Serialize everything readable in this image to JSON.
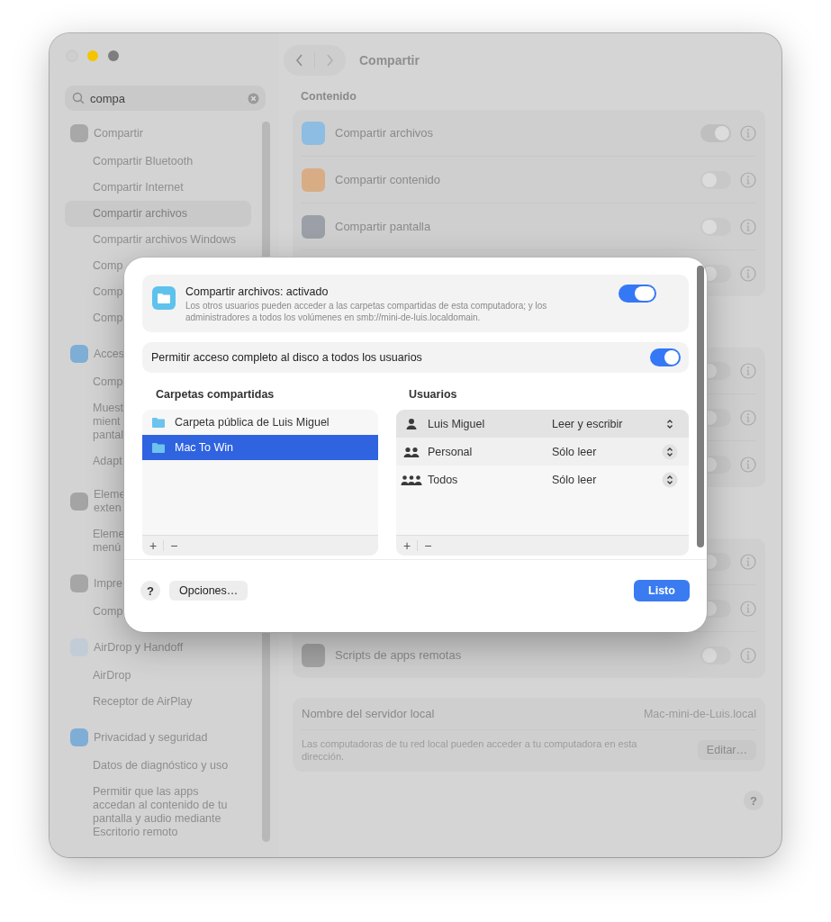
{
  "sidebar": {
    "search": {
      "value": "compa"
    },
    "items": [
      {
        "kind": "group",
        "label": "Compartir",
        "color": "#a8a8a8",
        "selected": false
      },
      {
        "kind": "item",
        "label": "Compartir Bluetooth",
        "selected": false
      },
      {
        "kind": "item",
        "label": "Compartir Internet",
        "selected": false
      },
      {
        "kind": "item",
        "label": "Compartir archivos",
        "selected": true
      },
      {
        "kind": "item",
        "label": "Compartir archivos Windows",
        "selected": false
      },
      {
        "kind": "item",
        "label": "Comp",
        "selected": false
      },
      {
        "kind": "item",
        "label": "Comp",
        "selected": false
      },
      {
        "kind": "item",
        "label": "Comp",
        "selected": false
      },
      {
        "kind": "group",
        "label": "Acces",
        "color": "#7eaed6",
        "selected": false
      },
      {
        "kind": "item",
        "label": "Comp",
        "selected": false
      },
      {
        "kind": "item",
        "label": "Muest\nmient\npantal",
        "selected": false
      },
      {
        "kind": "item",
        "label": "Adapt",
        "selected": false
      },
      {
        "kind": "group",
        "label": "Eleme\nexten",
        "color": "#a4a4a4",
        "selected": false
      },
      {
        "kind": "item",
        "label": "Eleme\nmenú",
        "selected": false
      },
      {
        "kind": "group",
        "label": "Impre",
        "color": "#a6a6a6",
        "selected": false
      },
      {
        "kind": "item",
        "label": "Comp",
        "selected": false
      },
      {
        "kind": "group",
        "label": "AirDrop y Handoff",
        "color": "#c2ccd6",
        "selected": false
      },
      {
        "kind": "item",
        "label": "AirDrop",
        "selected": false
      },
      {
        "kind": "item",
        "label": "Receptor de AirPlay",
        "selected": false
      },
      {
        "kind": "group",
        "label": "Privacidad y seguridad",
        "color": "#7eaed6",
        "selected": false
      },
      {
        "kind": "item",
        "label": "Datos de diagnóstico y uso",
        "selected": false
      },
      {
        "kind": "item",
        "label": "Permitir que las apps\naccedan al contenido de tu\npantalla y audio mediante\nEscritorio remoto",
        "selected": false
      }
    ]
  },
  "content": {
    "title": "Compartir",
    "sections": [
      {
        "heading": "Contenido",
        "rows": [
          {
            "label": "Compartir archivos",
            "color": "#8dbde3",
            "on": true
          },
          {
            "label": "Compartir contenido",
            "color": "#d8ad85",
            "on": false
          },
          {
            "label": "Compartir pantalla",
            "color": "#9a9fa8",
            "on": false
          },
          {
            "on": false
          }
        ]
      },
      {
        "rows": [
          {
            "on": false
          },
          {
            "on": false
          },
          {
            "on": false
          }
        ]
      },
      {
        "rows": [
          {
            "on": false
          },
          {
            "on": false
          },
          {
            "label": "Scripts de apps remotas",
            "color": "#a3a3a3",
            "on": false
          }
        ]
      }
    ],
    "server": {
      "label": "Nombre del servidor local",
      "value": "Mac-mini-de-Luis.local",
      "description": "Las computadoras de tu red local pueden acceder a tu computadora en esta dirección.",
      "button": "Editar…"
    },
    "help": "?"
  },
  "sheet": {
    "status": {
      "title": "Compartir archivos: activado",
      "description": "Los otros usuarios pueden acceder a las carpetas compartidas de esta computadora; y los administradores a todos los volúmenes en smb://mini-de-luis.localdomain.",
      "on": true
    },
    "full_access": {
      "label": "Permitir acceso completo al disco a todos los usuarios",
      "on": true
    },
    "folders": {
      "heading": "Carpetas compartidas",
      "items": [
        {
          "name": "Carpeta pública de Luis Miguel",
          "selected": false
        },
        {
          "name": "Mac To Win",
          "selected": true
        }
      ],
      "add": "+",
      "remove": "−"
    },
    "users": {
      "heading": "Usuarios",
      "items": [
        {
          "name": "Luis Miguel",
          "kind": "single",
          "permission": "Leer y escribir",
          "selected": true
        },
        {
          "name": "Personal",
          "kind": "pair",
          "permission": "Sólo leer",
          "selected": false
        },
        {
          "name": "Todos",
          "kind": "group",
          "permission": "Sólo leer",
          "selected": false
        }
      ],
      "add": "+",
      "remove": "−"
    },
    "help": "?",
    "options": "Opciones…",
    "done": "Listo"
  }
}
